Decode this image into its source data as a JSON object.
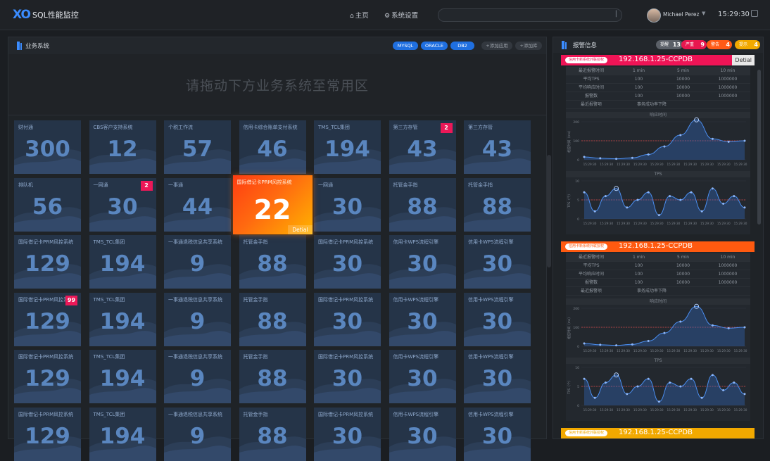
{
  "header": {
    "logo": "XO",
    "title": "SQL性能监控",
    "nav": [
      {
        "label": "主页",
        "icon": "home-icon"
      },
      {
        "label": "系统设置",
        "icon": "gear-icon"
      }
    ],
    "search_placeholder": "",
    "user": "Michael Perez",
    "time": "15:29:30"
  },
  "left": {
    "title": "业务系统",
    "db_tags": [
      "MYSQL",
      "ORACLE",
      "DB2"
    ],
    "add_app": "+添加应用",
    "add_db": "+添加库",
    "drop_hint": "请拖动下方业务系统至常用区",
    "tiles": [
      {
        "name": "财付通",
        "value": "300"
      },
      {
        "name": "CBS客户支持系统",
        "value": "12"
      },
      {
        "name": "个税工作流",
        "value": "57"
      },
      {
        "name": "信用卡综合账单支付系统",
        "value": "46"
      },
      {
        "name": "TMS_TCL集团",
        "value": "194"
      },
      {
        "name": "第三方存管",
        "value": "43",
        "badge": "2"
      },
      {
        "name": "第三方存管",
        "value": "43"
      },
      {
        "name": "排队机",
        "value": "56"
      },
      {
        "name": "一网通",
        "value": "30",
        "badge": "2"
      },
      {
        "name": "一事通",
        "value": "44"
      },
      {
        "name": "国际借记卡PRM风控系统",
        "value": "22",
        "hot": true,
        "detail": "Detial"
      },
      {
        "name": "一网通",
        "value": "30"
      },
      {
        "name": "托管金手指",
        "value": "88"
      },
      {
        "name": "托管金手指",
        "value": "88"
      },
      {
        "name": "国际借记卡PRM风控系统",
        "value": "129"
      },
      {
        "name": "TMS_TCL集团",
        "value": "194"
      },
      {
        "name": "一事通退税信息共享系统",
        "value": "9"
      },
      {
        "name": "托管金手指",
        "value": "88"
      },
      {
        "name": "国际借记卡PRM风控系统",
        "value": "30"
      },
      {
        "name": "信用卡WPS流程引擎",
        "value": "30"
      },
      {
        "name": "信用卡WPS流程引擎",
        "value": "30"
      },
      {
        "name": "国际借记卡PRM风控系统",
        "value": "129",
        "badge": "99"
      },
      {
        "name": "TMS_TCL集团",
        "value": "194"
      },
      {
        "name": "一事通退税信息共享系统",
        "value": "9"
      },
      {
        "name": "托管金手指",
        "value": "88"
      },
      {
        "name": "国际借记卡PRM风控系统",
        "value": "30"
      },
      {
        "name": "信用卡WPS流程引擎",
        "value": "30"
      },
      {
        "name": "信用卡WPS流程引擎",
        "value": "30"
      },
      {
        "name": "国际借记卡PRM风控系统",
        "value": "129"
      },
      {
        "name": "TMS_TCL集团",
        "value": "194"
      },
      {
        "name": "一事通退税信息共享系统",
        "value": "9"
      },
      {
        "name": "托管金手指",
        "value": "88"
      },
      {
        "name": "国际借记卡PRM风控系统",
        "value": "30"
      },
      {
        "name": "信用卡WPS流程引擎",
        "value": "30"
      },
      {
        "name": "信用卡WPS流程引擎",
        "value": "30"
      },
      {
        "name": "国际借记卡PRM风控系统",
        "value": "129"
      },
      {
        "name": "TMS_TCL集团",
        "value": "194"
      },
      {
        "name": "一事通退税信息共享系统",
        "value": "9"
      },
      {
        "name": "托管金手指",
        "value": "88"
      },
      {
        "name": "国际借记卡PRM风控系统",
        "value": "30"
      },
      {
        "name": "信用卡WPS流程引擎",
        "value": "30"
      },
      {
        "name": "信用卡WPS流程引擎",
        "value": "30"
      }
    ]
  },
  "right": {
    "title": "报警信息",
    "counts": [
      {
        "label": "提醒",
        "value": "13",
        "color": "#5b6068"
      },
      {
        "label": "严重",
        "value": "9",
        "color": "#e8174f"
      },
      {
        "label": "警告",
        "value": "4",
        "color": "#ff5a16"
      },
      {
        "label": "提示",
        "value": "4",
        "color": "#f2a900"
      }
    ],
    "alerts": [
      {
        "tag": "信用卡新系统外联授权",
        "ip": "192.168.1.25-CCPDB",
        "color": "#ef1456",
        "detail": "Detial",
        "table_header": [
          "最近报警时间",
          "1 min",
          "5 min",
          "10 min"
        ],
        "rows": [
          [
            "平均TPS",
            "100",
            "10000",
            "1000000"
          ],
          [
            "平均响应时间",
            "100",
            "10000",
            "1000000"
          ],
          [
            "报警数",
            "100",
            "10000",
            "1000000"
          ]
        ],
        "last_label": "最近报警项",
        "last_value": "事务成功率下降",
        "chart1_title": "响应时间",
        "chart2_title": "TPS"
      },
      {
        "tag": "信用卡新系统外联授权",
        "ip": "192.168.1.25-CCPDB",
        "color": "#ff5a10",
        "detail": "",
        "table_header": [
          "最近报警时间",
          "1 min",
          "5 min",
          "10 min"
        ],
        "rows": [
          [
            "平均TPS",
            "100",
            "10000",
            "1000000"
          ],
          [
            "平均响应时间",
            "100",
            "10000",
            "1000000"
          ],
          [
            "报警数",
            "100",
            "10000",
            "1000000"
          ]
        ],
        "last_label": "最近报警项",
        "last_value": "事务成功率下降",
        "chart1_title": "响应时间",
        "chart2_title": "TPS"
      },
      {
        "tag": "信用卡新系统外联授权",
        "ip": "192.168.1.25-CCPDB",
        "color": "#f2a900"
      }
    ],
    "chart_axis": {
      "resp_ylabel": "相应时间（ms）",
      "tps_ylabel": "TPS（个）",
      "times": [
        "15:29:30",
        "15:29:30",
        "15:29:30",
        "15:29:30",
        "15:29:30",
        "15:29:30",
        "15:29:30",
        "15:29:30",
        "15:29:30",
        "15:29:30"
      ],
      "resp_ticks": [
        "200",
        "100",
        "0"
      ],
      "tps_ticks": [
        "10",
        "5",
        "0"
      ]
    }
  },
  "chart_data": [
    {
      "type": "line",
      "title": "响应时间",
      "ylabel": "相应时间（ms）",
      "x": [
        "15:29:30",
        "15:29:30",
        "15:29:30",
        "15:29:30",
        "15:29:30",
        "15:29:30",
        "15:29:30",
        "15:29:30",
        "15:29:30",
        "15:29:30"
      ],
      "values": [
        15,
        8,
        5,
        10,
        28,
        70,
        130,
        210,
        110,
        95,
        100
      ],
      "ylim": [
        0,
        200
      ],
      "threshold": 100
    },
    {
      "type": "line",
      "title": "TPS",
      "ylabel": "TPS（个）",
      "x": [
        "15:29:30",
        "15:29:30",
        "15:29:30",
        "15:29:30",
        "15:29:30",
        "15:29:30",
        "15:29:30",
        "15:29:30",
        "15:29:30",
        "15:29:30"
      ],
      "values": [
        7,
        2,
        6,
        8,
        3,
        5,
        7,
        1,
        6,
        5,
        7,
        2,
        8,
        4,
        6,
        3
      ],
      "ylim": [
        0,
        10
      ],
      "threshold": 5
    }
  ]
}
